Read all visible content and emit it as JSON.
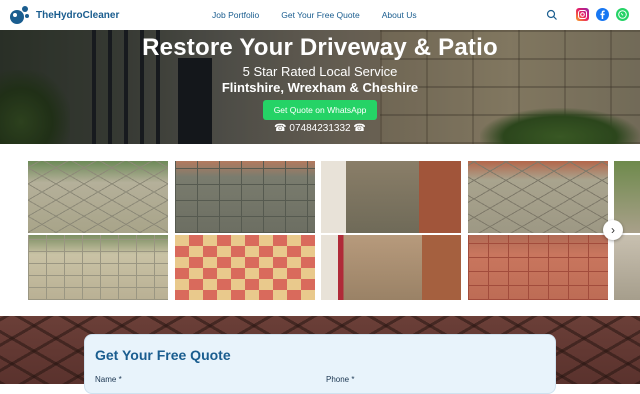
{
  "header": {
    "brand": "TheHydroCleaner",
    "nav": [
      "Job Portfolio",
      "Get Your Free Quote",
      "About Us"
    ],
    "icons": [
      "search-icon",
      "instagram-icon",
      "facebook-icon",
      "whatsapp-icon"
    ]
  },
  "hero": {
    "title": "Restore Your Driveway & Patio",
    "subtitle": "5 Star Rated Local Service",
    "areas": "Flintshire, Wrexham & Cheshire",
    "cta": "Get Quote on WhatsApp",
    "phone": "☎ 07484231332 ☎"
  },
  "gallery": {
    "next": "›"
  },
  "form": {
    "title": "Get Your Free Quote",
    "name_label": "Name *",
    "phone_label": "Phone *"
  },
  "colors": {
    "brand": "#1a5d8f",
    "whatsapp": "#25d366",
    "form_bg": "#e8f3fb"
  }
}
